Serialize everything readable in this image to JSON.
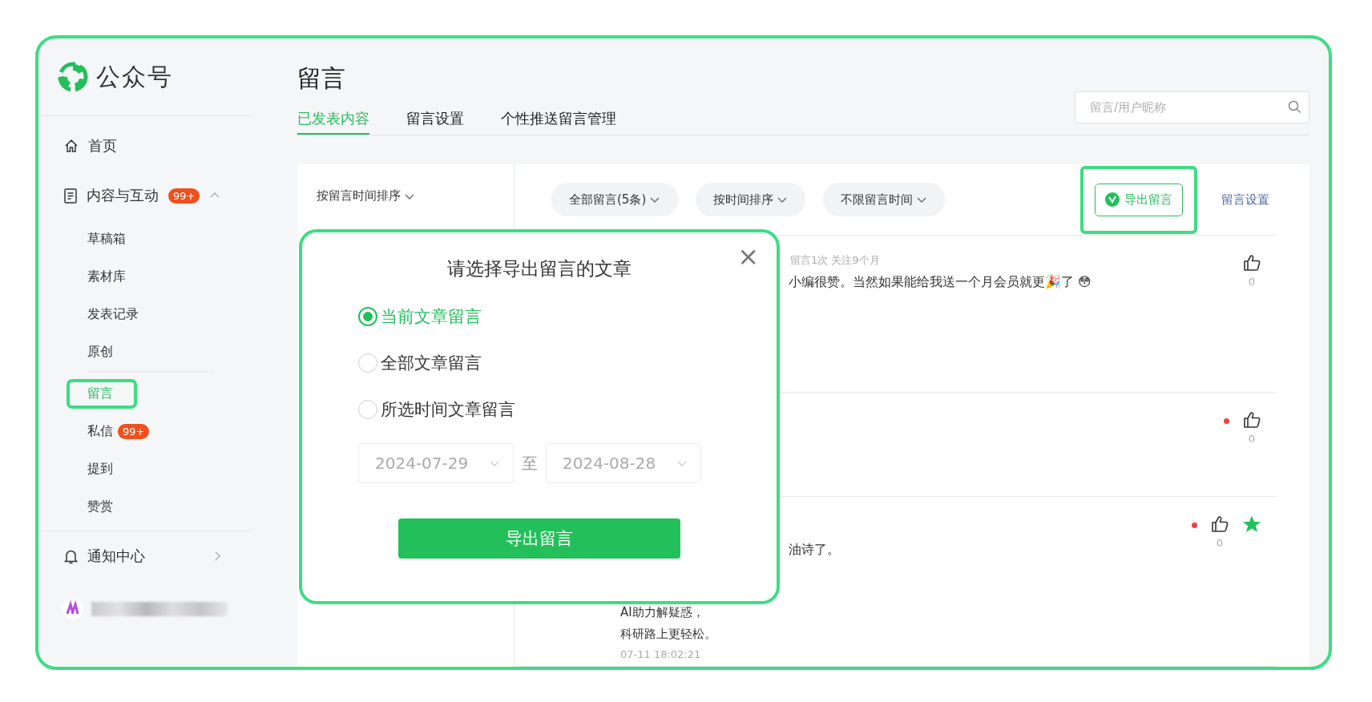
{
  "sidebar": {
    "logo": "公众号",
    "items": [
      {
        "kind": "home",
        "label": "首页",
        "selected": false
      },
      {
        "kind": "group",
        "label": "内容与互动",
        "badge": "99+",
        "expanded": true,
        "children": [
          {
            "label": "草稿箱",
            "selected": false
          },
          {
            "label": "素材库",
            "selected": false
          },
          {
            "label": "发表记录",
            "selected": false
          },
          {
            "label": "原创",
            "selected": false
          },
          {
            "label": "留言",
            "selected": true,
            "highlighted": true
          },
          {
            "label": "私信",
            "badge": "99+",
            "selected": false
          },
          {
            "label": "提到",
            "selected": false
          },
          {
            "label": "赞赏",
            "selected": false
          }
        ]
      },
      {
        "kind": "notice",
        "label": "通知中心",
        "selected": false
      }
    ]
  },
  "page": {
    "title": "留言",
    "tabs": [
      {
        "label": "已发表内容",
        "selected": true
      },
      {
        "label": "留言设置",
        "selected": false
      },
      {
        "label": "个性推送留言管理",
        "selected": false
      }
    ],
    "search": {
      "placeholder": "留言/用户昵称"
    },
    "article_sort": "按留言时间排序",
    "filters": [
      "全部留言(5条)",
      "按时间排序",
      "不限留言时间"
    ],
    "export_button": {
      "label": "导出留言",
      "highlighted": true
    },
    "settings_link": "留言设置",
    "comments": [
      {
        "lines": [
          {
            "kind": "meta",
            "text": "留言1次 关注9个月"
          },
          {
            "kind": "partial",
            "text": "小编很赞。当然如果能给我送一个月会员就更🎉了 😳"
          }
        ],
        "likes": "0",
        "flagged": false,
        "starred": false
      },
      {
        "likes": "0",
        "flagged": true,
        "starred": false
      },
      {
        "lines": [
          {
            "kind": "partial",
            "text": "油诗了。"
          },
          {
            "kind": "reply",
            "text": "AI助力解疑惑，"
          },
          {
            "kind": "reply",
            "text": "科研路上更轻松。"
          },
          {
            "kind": "time",
            "text": "07-11 18:02:21"
          }
        ],
        "likes": "0",
        "flagged": true,
        "starred": true
      }
    ]
  },
  "dialog": {
    "title": "请选择导出留言的文章",
    "close": "×",
    "options": [
      {
        "label": "当前文章留言",
        "selected": true
      },
      {
        "label": "全部文章留言",
        "selected": false
      },
      {
        "label": "所选时间文章留言",
        "selected": false
      }
    ],
    "date_from": "2024-07-29",
    "date_sep": "至",
    "date_to": "2024-08-28",
    "dates_disabled": true,
    "submit": "导出留言",
    "highlighted": true
  }
}
